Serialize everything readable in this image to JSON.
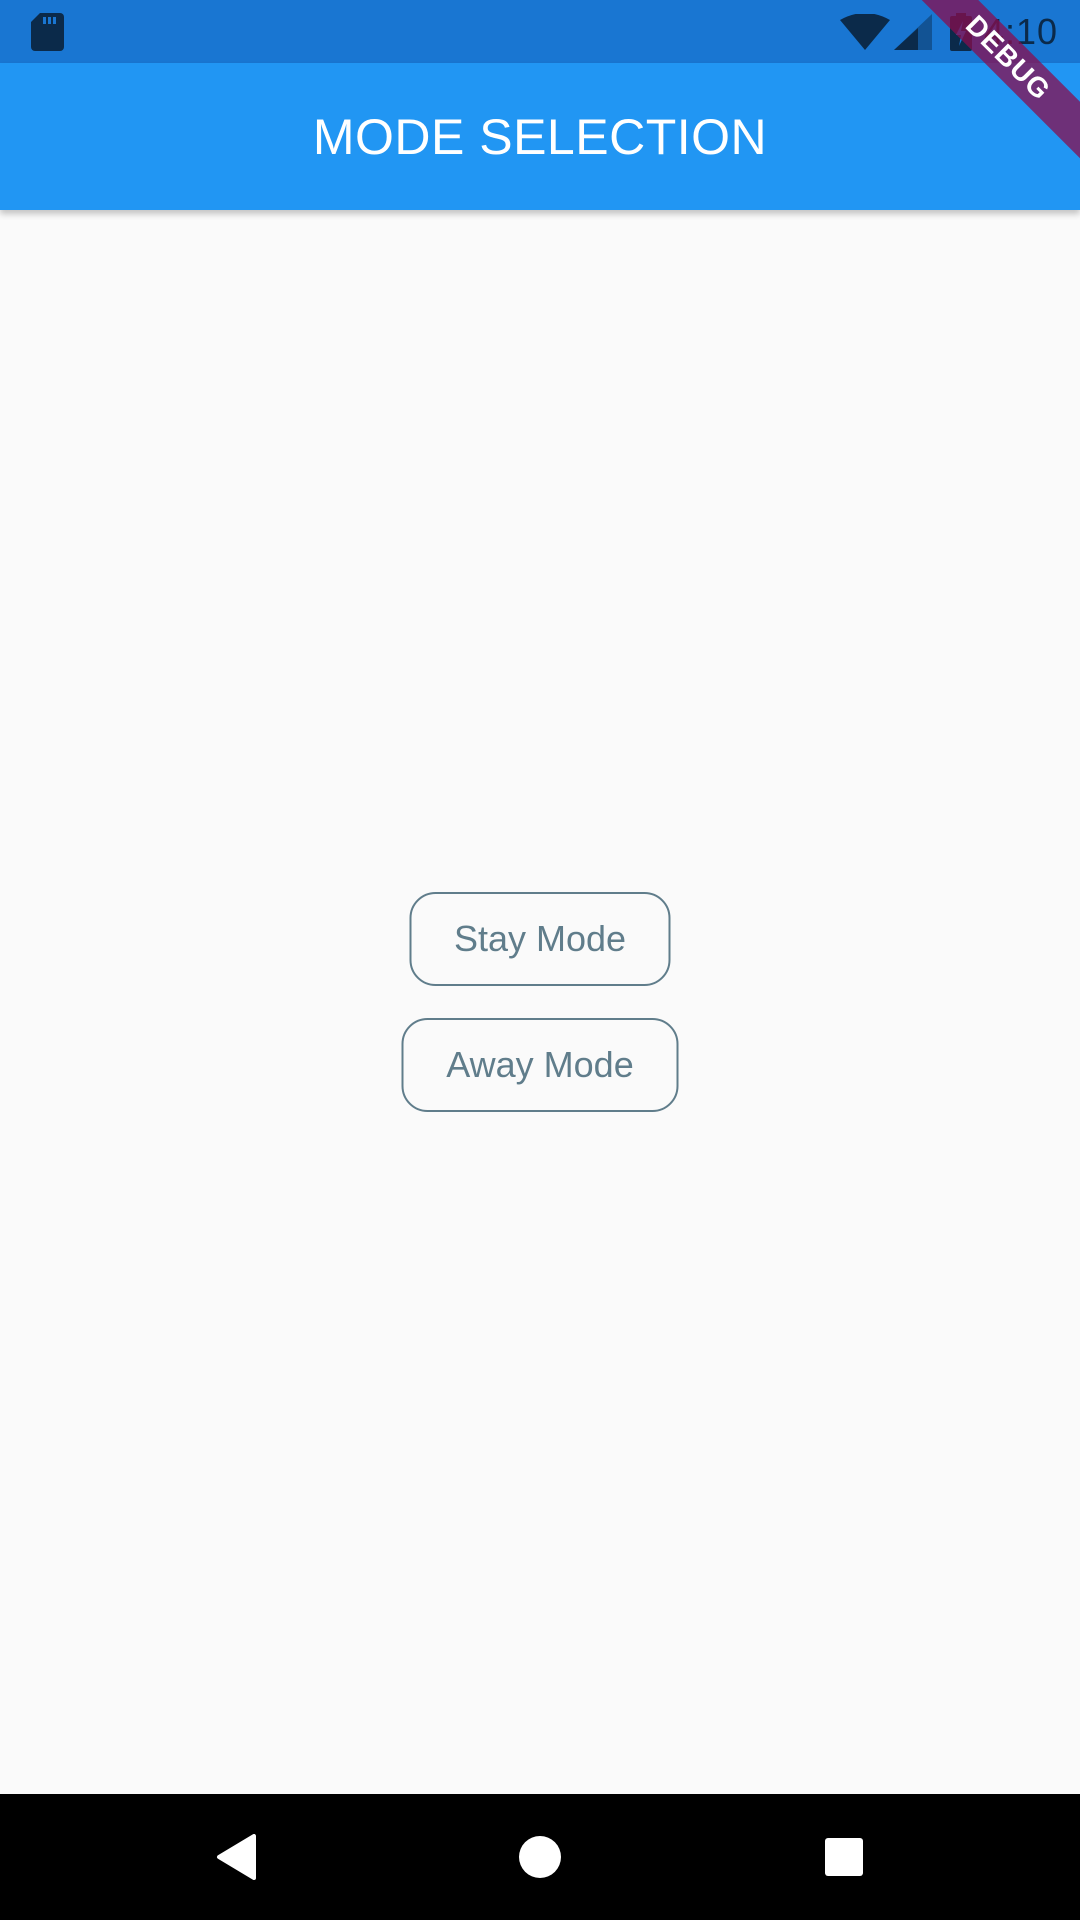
{
  "status_bar": {
    "time": "4:10",
    "icons": [
      "sd-card-icon",
      "wifi-icon",
      "signal-icon",
      "battery-charging-icon"
    ],
    "background_color": "#1976d2"
  },
  "app_bar": {
    "title": "MODE SELECTION",
    "background_color": "#2196f3"
  },
  "debug_banner": {
    "label": "DEBUG"
  },
  "mode_buttons": [
    {
      "label": "Stay Mode"
    },
    {
      "label": "Away Mode"
    }
  ],
  "button_color": "#607d8b",
  "nav_bar": {
    "icons": [
      "back-icon",
      "home-icon",
      "recent-apps-icon"
    ]
  }
}
